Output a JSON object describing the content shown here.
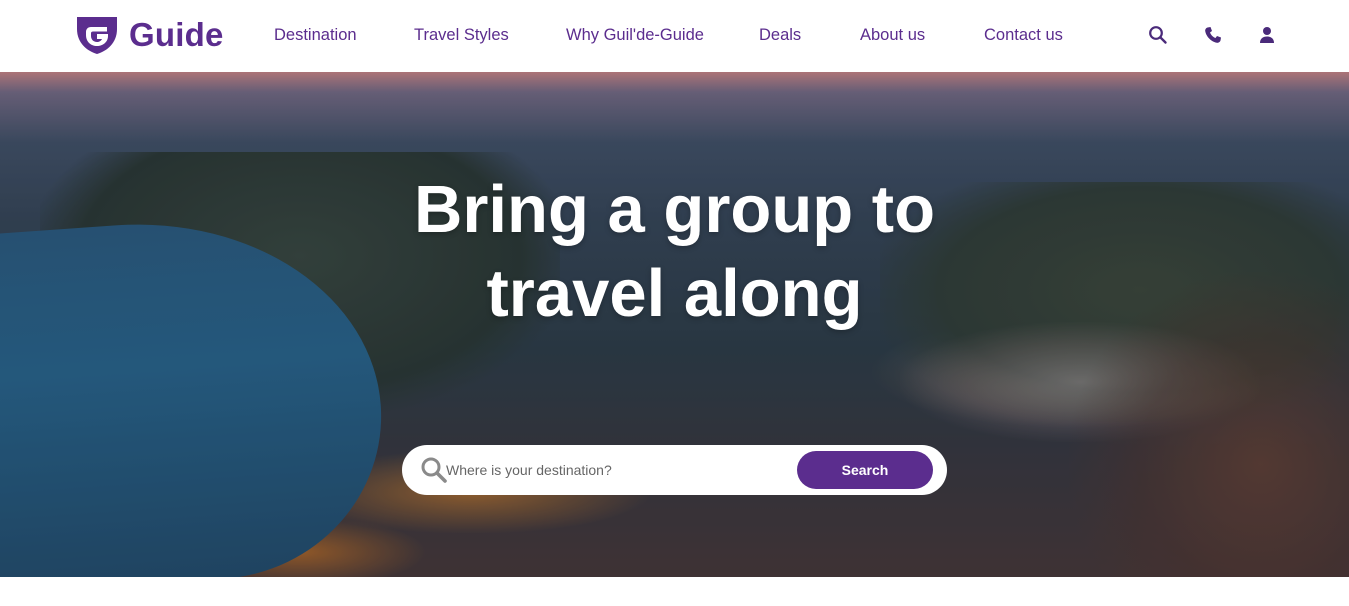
{
  "brand": {
    "name": "Guide",
    "logo_icon": "shield-g-logo",
    "color": "#5b2d8e"
  },
  "nav": {
    "items": [
      {
        "label": "Destination"
      },
      {
        "label": "Travel Styles"
      },
      {
        "label": "Why Guil'de-Guide"
      },
      {
        "label": "Deals"
      },
      {
        "label": "About us"
      },
      {
        "label": "Contact us"
      }
    ],
    "icons": [
      "search-icon",
      "phone-icon",
      "user-icon"
    ]
  },
  "hero": {
    "title_line1": "Bring a group to",
    "title_line2": "travel along",
    "background": "dusk landscape with lake, hills and town lights"
  },
  "search": {
    "placeholder": "Where is your destination?",
    "value": "",
    "button_label": "Search",
    "button_color": "#5b2d8e"
  }
}
